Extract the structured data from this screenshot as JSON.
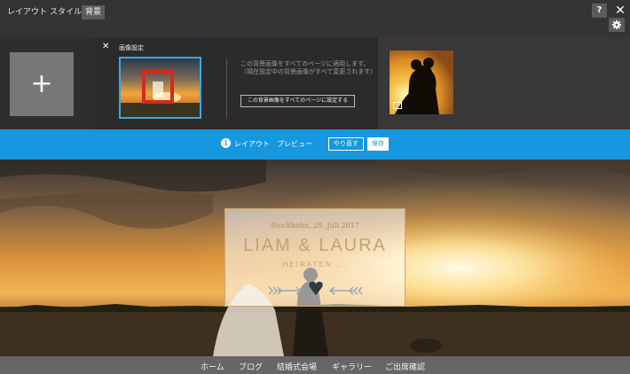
{
  "toolbar": {
    "tabs": [
      {
        "label": "レイアウト"
      },
      {
        "label": "スタイル"
      },
      {
        "label": "背景"
      }
    ],
    "help_label": "?",
    "close_label": "✕"
  },
  "panel": {
    "add_label": "+",
    "close_label": "✕",
    "title": "画像設定",
    "description": "この背景画像をすべてのページに適用します。（現在設定中の背景画像がすべて変更されます）",
    "apply_button": "この背景画像をすべてのページに設定する"
  },
  "preview_bar": {
    "info_icon": "i",
    "label": "レイアウト　プレビュー",
    "redo_button": "やり直す",
    "save_button": "保存"
  },
  "hero": {
    "date": "Stockholm, 29. Juli 2017",
    "names": "LIAM & LAURA",
    "subtitle": "HEIRATEN ..."
  },
  "nav": {
    "items": [
      {
        "label": "ホーム"
      },
      {
        "label": "ブログ"
      },
      {
        "label": "結婚式会場"
      },
      {
        "label": "ギャラリー"
      },
      {
        "label": "ご出席確認"
      }
    ]
  },
  "colors": {
    "accent_blue": "#1797de",
    "gold": "#c3a373",
    "selected_border": "#3aa8e6"
  },
  "icons": [
    "help-icon",
    "close-icon",
    "gear-icon",
    "plus-icon",
    "info-icon",
    "image-icon",
    "heart-icon",
    "arrow-icon"
  ]
}
